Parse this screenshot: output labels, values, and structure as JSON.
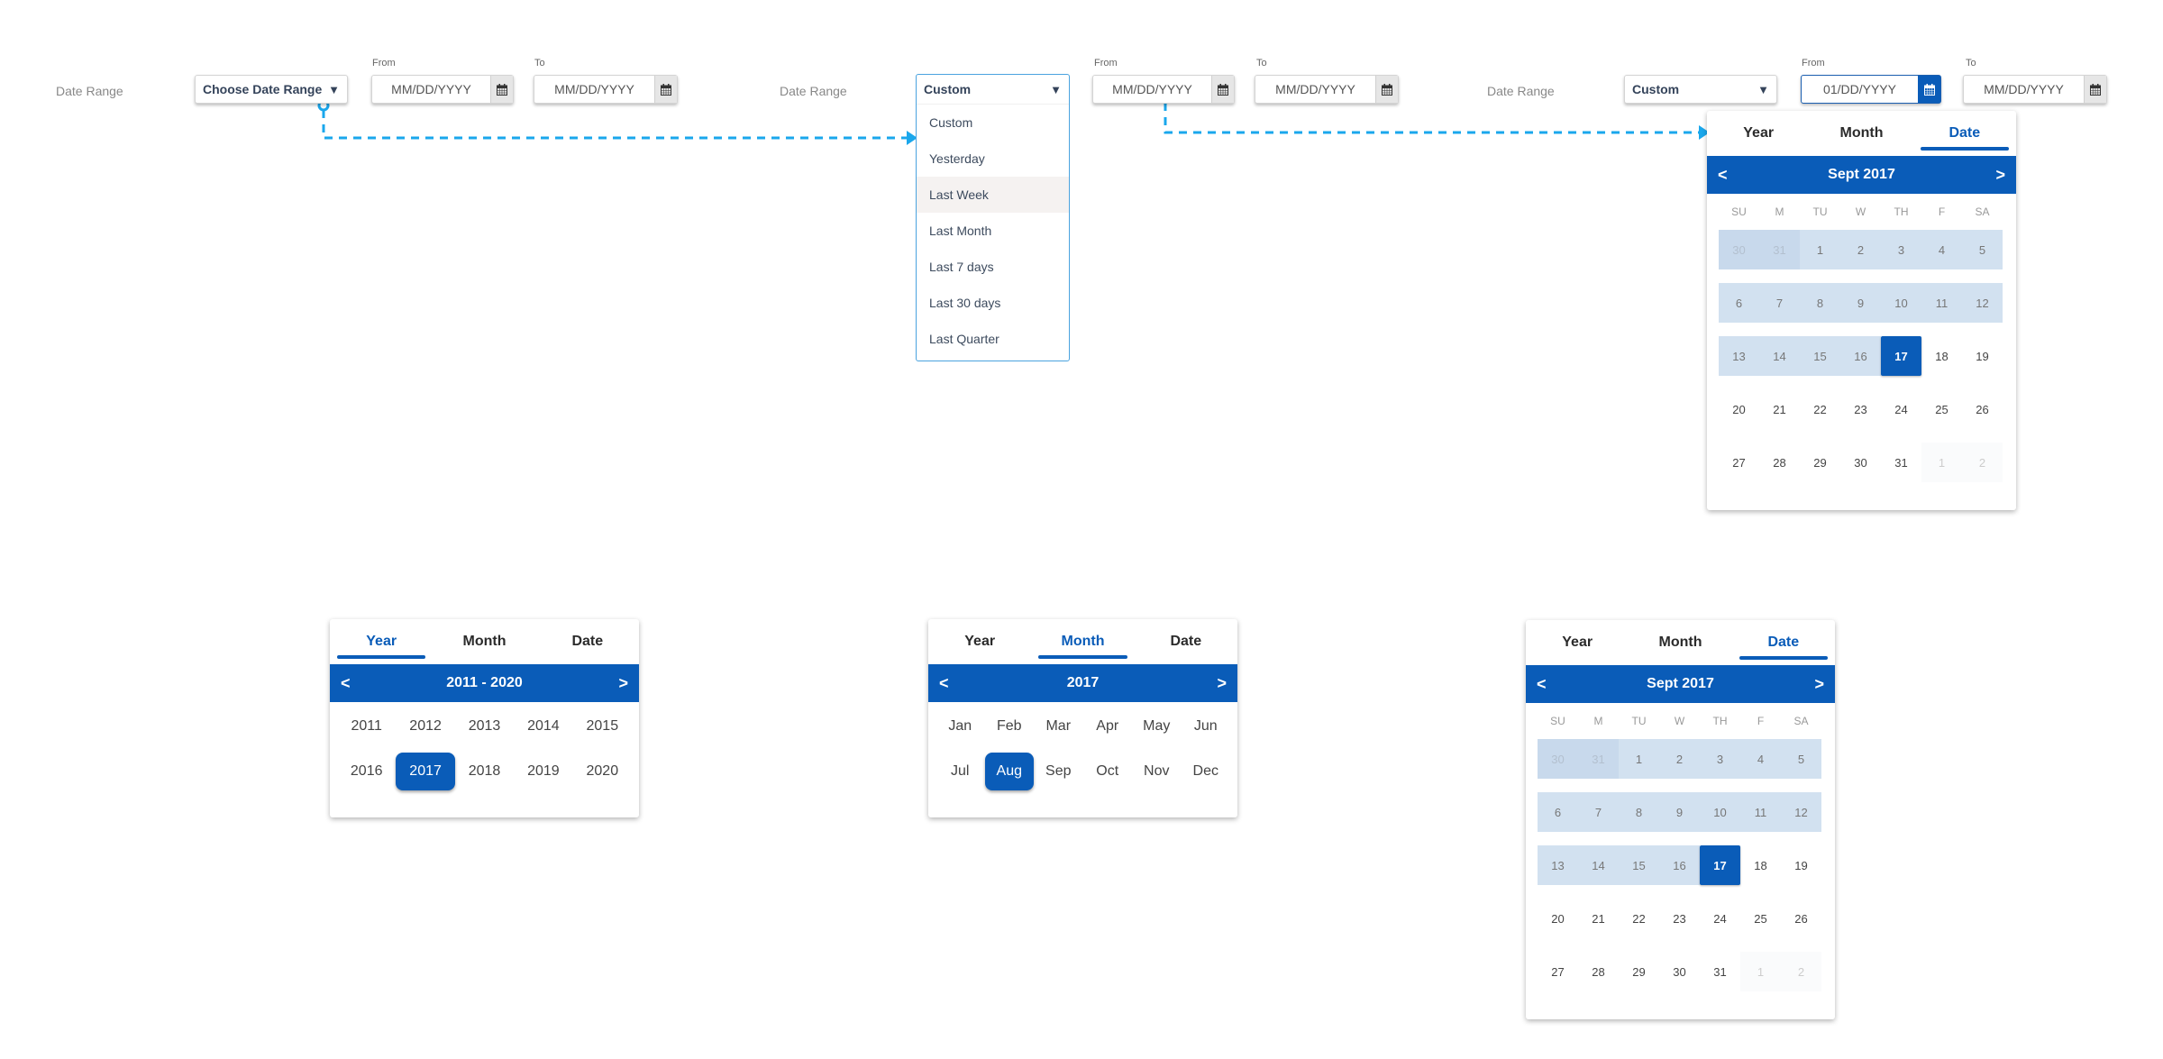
{
  "state1": {
    "date_range_label": "Date Range",
    "select_value": "Choose Date Range",
    "from_label": "From",
    "to_label": "To",
    "from_value": "MM/DD/YYYY",
    "to_value": "MM/DD/YYYY"
  },
  "state2": {
    "date_range_label": "Date Range",
    "select_value": "Custom",
    "from_label": "From",
    "to_label": "To",
    "from_value": "MM/DD/YYYY",
    "to_value": "MM/DD/YYYY",
    "options": [
      "Custom",
      "Yesterday",
      "Last Week",
      "Last Month",
      "Last 7 days",
      "Last 30 days",
      "Last Quarter"
    ],
    "hovered_option": "Last Week"
  },
  "state3": {
    "date_range_label": "Date Range",
    "select_value": "Custom",
    "from_label": "From",
    "to_label": "To",
    "from_value": "01/DD/YYYY",
    "to_value": "MM/DD/YYYY"
  },
  "tabs": [
    "Year",
    "Month",
    "Date"
  ],
  "weekdays": [
    "SU",
    "M",
    "TU",
    "W",
    "TH",
    "F",
    "SA"
  ],
  "date_picker": {
    "title": "Sept 2017",
    "selected_day": "17",
    "weeks": [
      [
        {
          "d": "30",
          "t": "other-range"
        },
        {
          "d": "31",
          "t": "other-range"
        },
        {
          "d": "1",
          "t": "range"
        },
        {
          "d": "2",
          "t": "range"
        },
        {
          "d": "3",
          "t": "range"
        },
        {
          "d": "4",
          "t": "range"
        },
        {
          "d": "5",
          "t": "range"
        }
      ],
      [
        {
          "d": "6",
          "t": "range"
        },
        {
          "d": "7",
          "t": "range"
        },
        {
          "d": "8",
          "t": "range"
        },
        {
          "d": "9",
          "t": "range"
        },
        {
          "d": "10",
          "t": "range"
        },
        {
          "d": "11",
          "t": "range"
        },
        {
          "d": "12",
          "t": "range"
        }
      ],
      [
        {
          "d": "13",
          "t": "range"
        },
        {
          "d": "14",
          "t": "range"
        },
        {
          "d": "15",
          "t": "range"
        },
        {
          "d": "16",
          "t": "range"
        },
        {
          "d": "17",
          "t": "selected"
        },
        {
          "d": "18",
          "t": "normal"
        },
        {
          "d": "19",
          "t": "normal"
        }
      ],
      [
        {
          "d": "20",
          "t": "normal"
        },
        {
          "d": "21",
          "t": "normal"
        },
        {
          "d": "22",
          "t": "normal"
        },
        {
          "d": "23",
          "t": "normal"
        },
        {
          "d": "24",
          "t": "normal"
        },
        {
          "d": "25",
          "t": "normal"
        },
        {
          "d": "26",
          "t": "normal"
        }
      ],
      [
        {
          "d": "27",
          "t": "normal"
        },
        {
          "d": "28",
          "t": "normal"
        },
        {
          "d": "29",
          "t": "normal"
        },
        {
          "d": "30",
          "t": "normal"
        },
        {
          "d": "31",
          "t": "normal"
        },
        {
          "d": "1",
          "t": "other"
        },
        {
          "d": "2",
          "t": "other"
        }
      ]
    ]
  },
  "year_picker": {
    "title": "2011 - 2020",
    "years": [
      "2011",
      "2012",
      "2013",
      "2014",
      "2015",
      "2016",
      "2017",
      "2018",
      "2019",
      "2020"
    ],
    "selected": "2017"
  },
  "month_picker": {
    "title": "2017",
    "months": [
      "Jan",
      "Feb",
      "Mar",
      "Apr",
      "May",
      "Jun",
      "Jul",
      "Aug",
      "Sep",
      "Oct",
      "Nov",
      "Dec"
    ],
    "selected": "Aug"
  },
  "nav": {
    "prev": "<",
    "next": ">"
  },
  "icons": {
    "caret": "▼"
  },
  "colors": {
    "accent": "#0a5cb8",
    "connector": "#1aa7ec",
    "range": "#d2e1f0"
  }
}
